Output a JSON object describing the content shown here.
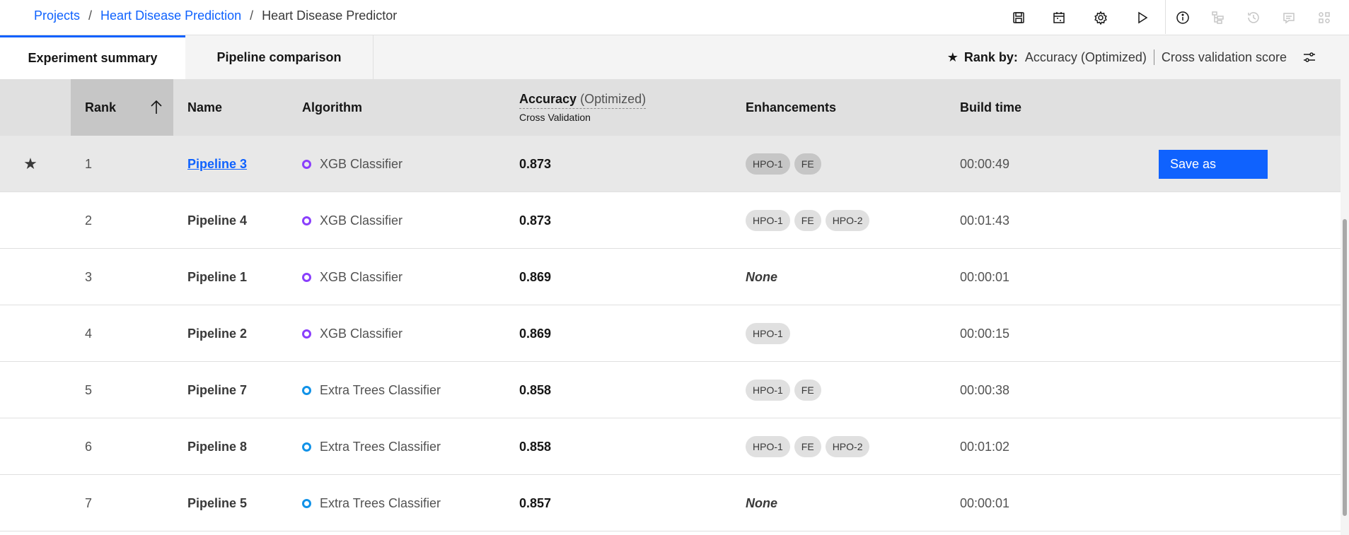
{
  "breadcrumb": {
    "items": [
      "Projects",
      "Heart Disease Prediction"
    ],
    "separator": "/",
    "current": "Heart Disease Predictor"
  },
  "toolbar": {
    "icons": [
      "save-icon",
      "calendar-icon",
      "gear-icon",
      "play-icon",
      "info-icon",
      "hierarchy-icon",
      "history-icon",
      "comment-icon",
      "apps-icon"
    ]
  },
  "tabs": [
    {
      "label": "Experiment summary",
      "active": true
    },
    {
      "label": "Pipeline comparison",
      "active": false
    }
  ],
  "rank_by": {
    "star": "★",
    "label": "Rank by:",
    "metric": "Accuracy (Optimized)",
    "score": "Cross validation score"
  },
  "table": {
    "headers": {
      "rank": "Rank",
      "name": "Name",
      "algorithm": "Algorithm",
      "accuracy": "Accuracy",
      "accuracy_opt": "(Optimized)",
      "accuracy_sub": "Cross Validation",
      "enhancements": "Enhancements",
      "build_time": "Build time"
    },
    "rows": [
      {
        "star": "★",
        "rank": "1",
        "name": "Pipeline 3",
        "algorithm": "XGB Classifier",
        "accuracy": "0.873",
        "enhancements": [
          "HPO-1",
          "FE"
        ],
        "build_time": "00:00:49",
        "action": "Save as"
      },
      {
        "star": "",
        "rank": "2",
        "name": "Pipeline 4",
        "algorithm": "XGB Classifier",
        "accuracy": "0.873",
        "enhancements": [
          "HPO-1",
          "FE",
          "HPO-2"
        ],
        "build_time": "00:01:43",
        "action": ""
      },
      {
        "star": "",
        "rank": "3",
        "name": "Pipeline 1",
        "algorithm": "XGB Classifier",
        "accuracy": "0.869",
        "enhancements": [],
        "none_label": "None",
        "build_time": "00:00:01",
        "action": ""
      },
      {
        "star": "",
        "rank": "4",
        "name": "Pipeline 2",
        "algorithm": "XGB Classifier",
        "accuracy": "0.869",
        "enhancements": [
          "HPO-1"
        ],
        "build_time": "00:00:15",
        "action": ""
      },
      {
        "star": "",
        "rank": "5",
        "name": "Pipeline 7",
        "algorithm": "Extra Trees Classifier",
        "accuracy": "0.858",
        "enhancements": [
          "HPO-1",
          "FE"
        ],
        "build_time": "00:00:38",
        "action": ""
      },
      {
        "star": "",
        "rank": "6",
        "name": "Pipeline 8",
        "algorithm": "Extra Trees Classifier",
        "accuracy": "0.858",
        "enhancements": [
          "HPO-1",
          "FE",
          "HPO-2"
        ],
        "build_time": "00:01:02",
        "action": ""
      },
      {
        "star": "",
        "rank": "7",
        "name": "Pipeline 5",
        "algorithm": "Extra Trees Classifier",
        "accuracy": "0.857",
        "enhancements": [],
        "none_label": "None",
        "build_time": "00:00:01",
        "action": ""
      }
    ]
  },
  "colors": {
    "accent": "#0f62fe",
    "xgb": "#8a3ffc",
    "extra_trees": "#1192e8"
  }
}
